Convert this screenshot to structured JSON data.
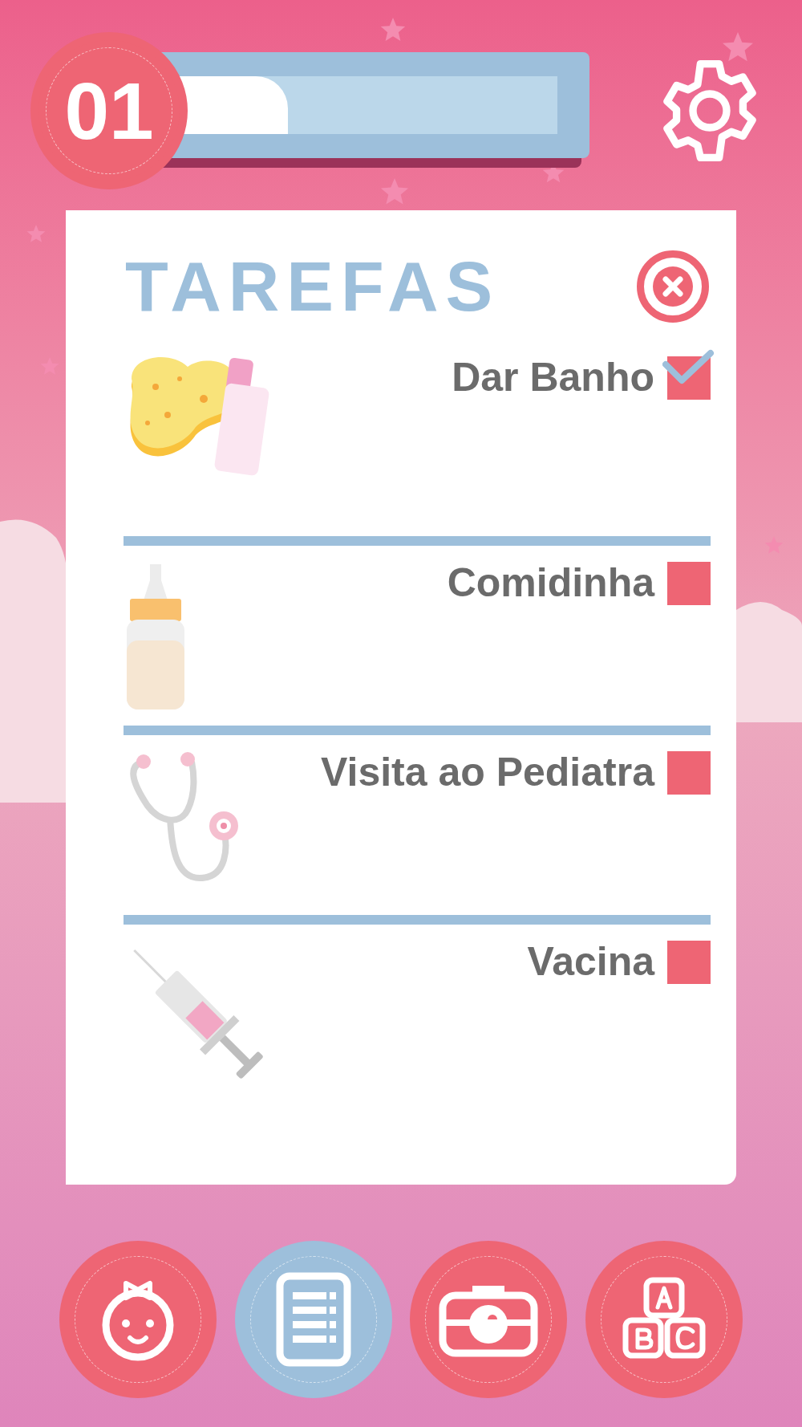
{
  "level_badge": "01",
  "progress": {
    "level": 0.3
  },
  "title": "TAREFAS",
  "tasks": [
    {
      "kind": "bath",
      "label": "Dar Banho",
      "checked": true
    },
    {
      "kind": "bottle",
      "label": "Comidinha",
      "checked": false
    },
    {
      "kind": "stethoscope",
      "label": "Visita ao Pediatra",
      "checked": false
    },
    {
      "kind": "syringe",
      "label": "Vacina",
      "checked": false
    }
  ],
  "nav": [
    {
      "kind": "baby",
      "selected": false
    },
    {
      "kind": "list",
      "selected": true
    },
    {
      "kind": "camera",
      "selected": false
    },
    {
      "kind": "blocks",
      "selected": false
    }
  ]
}
